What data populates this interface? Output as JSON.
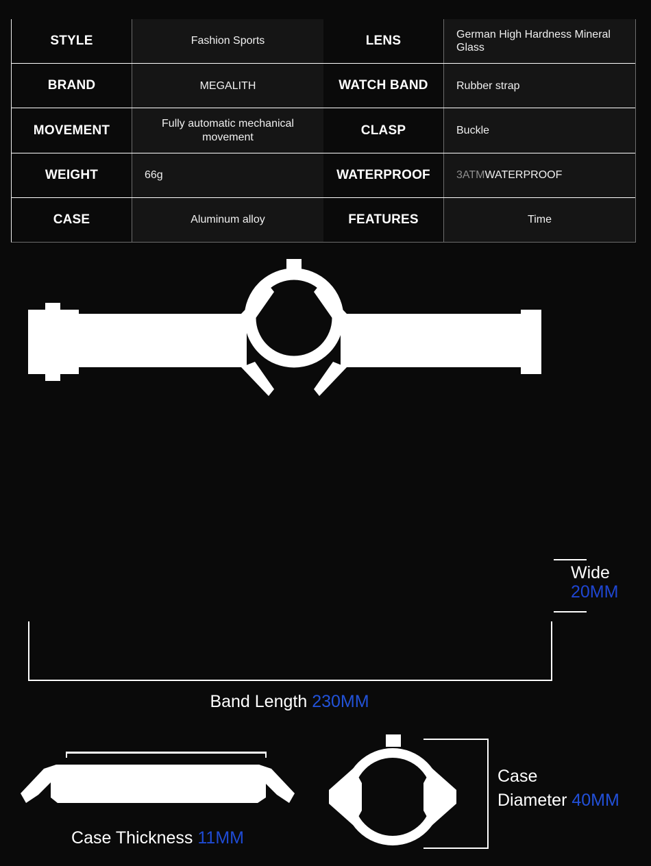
{
  "spec_table": {
    "rows": [
      {
        "left": {
          "label": "STYLE",
          "value": "Fashion Sports",
          "align": "center"
        },
        "right": {
          "label": "LENS",
          "value": "German High Hardness Mineral Glass",
          "align": "left"
        }
      },
      {
        "left": {
          "label": "BRAND",
          "value": "MEGALITH",
          "align": "center"
        },
        "right": {
          "label": "WATCH BAND",
          "value": "Rubber strap",
          "align": "left"
        }
      },
      {
        "left": {
          "label": "MOVEMENT",
          "value": "Fully automatic mechanical movement",
          "align": "center"
        },
        "right": {
          "label": "CLASP",
          "value": "Buckle",
          "align": "left"
        }
      },
      {
        "left": {
          "label": "WEIGHT",
          "value": "66g",
          "align": "left"
        },
        "right": {
          "label": "WATERPROOF",
          "value_muted": "3ATM",
          "value": " WATERPROOF",
          "align": "left"
        }
      },
      {
        "left": {
          "label": "CASE",
          "value": "Aluminum alloy",
          "align": "center"
        },
        "right": {
          "label": "FEATURES",
          "value": "Time",
          "align": "center"
        }
      }
    ]
  },
  "diagrams": {
    "band": {
      "wide": {
        "text": "Wide",
        "value": "20MM"
      },
      "band_length": {
        "text": "Band Length",
        "value": "230MM"
      }
    },
    "thickness": {
      "text": "Case Thickness",
      "value": "11MM"
    },
    "diameter": {
      "line1": "Case",
      "line2": "Diameter",
      "value": "40MM"
    }
  },
  "colors": {
    "background": "#0a0a0a",
    "cell_value_background": "#151515",
    "text": "#ffffff",
    "muted_text": "#8e8e8e",
    "accent_blue": "#2250d8",
    "divider": "#6e6e6e"
  }
}
